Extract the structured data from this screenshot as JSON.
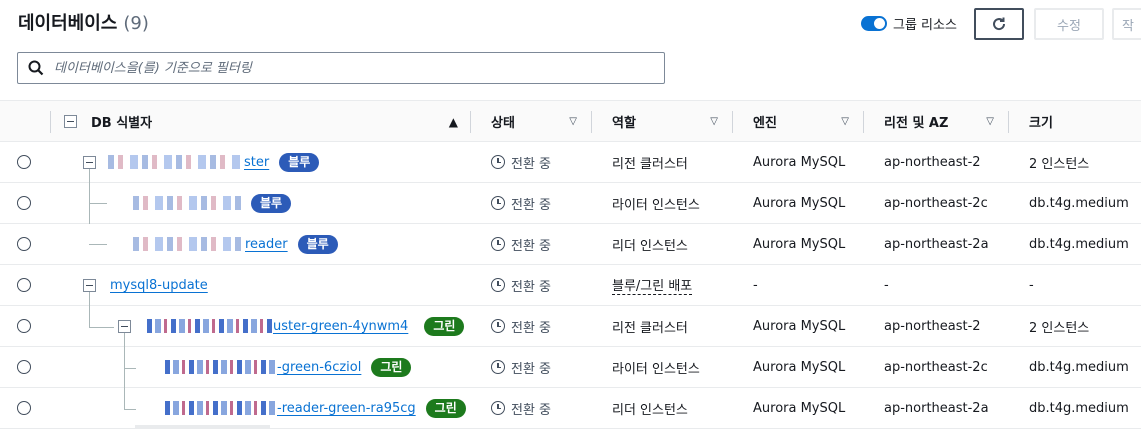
{
  "header": {
    "title": "데이터베이스",
    "count": "(9)",
    "group_toggle_label": "그룹 리소스",
    "edit_label": "수정",
    "more_label": "작"
  },
  "filter": {
    "placeholder": "데이터베이스을(를) 기준으로 필터링"
  },
  "columns": {
    "identifier": "DB 식별자",
    "status": "상태",
    "role": "역할",
    "engine": "엔진",
    "region": "리전 및 AZ",
    "size": "크기"
  },
  "rows": [
    {
      "id_suffix": "ster",
      "badge": "블루",
      "badge_color": "blue",
      "status": "전환 중",
      "role": "리전 클러스터",
      "engine": "Aurora MySQL",
      "region": "ap-northeast-2",
      "size": "2 인스턴스"
    },
    {
      "id_suffix": "",
      "badge": "블루",
      "badge_color": "blue",
      "status": "전환 중",
      "role": "라이터 인스턴스",
      "engine": "Aurora MySQL",
      "region": "ap-northeast-2c",
      "size": "db.t4g.medium"
    },
    {
      "id_suffix": "reader",
      "badge": "블루",
      "badge_color": "blue",
      "status": "전환 중",
      "role": "리더 인스턴스",
      "engine": "Aurora MySQL",
      "region": "ap-northeast-2a",
      "size": "db.t4g.medium"
    },
    {
      "id_suffix": "mysql8-update",
      "badge": "",
      "badge_color": "",
      "status": "전환 중",
      "role": "블루/그린 배포",
      "engine": "-",
      "region": "-",
      "size": "-"
    },
    {
      "id_suffix": "uster-green-4ynwm4",
      "badge": "그린",
      "badge_color": "green",
      "status": "전환 중",
      "role": "리전 클러스터",
      "engine": "Aurora MySQL",
      "region": "ap-northeast-2",
      "size": "2 인스턴스"
    },
    {
      "id_suffix": "-green-6cziol",
      "badge": "그린",
      "badge_color": "green",
      "status": "전환 중",
      "role": "라이터 인스턴스",
      "engine": "Aurora MySQL",
      "region": "ap-northeast-2c",
      "size": "db.t4g.medium"
    },
    {
      "id_suffix": "-reader-green-ra95cg",
      "badge": "그린",
      "badge_color": "green",
      "status": "전환 중",
      "role": "리더 인스턴스",
      "engine": "Aurora MySQL",
      "region": "ap-northeast-2a",
      "size": "db.t4g.medium"
    }
  ],
  "colors": {
    "accent": "#0972d3",
    "blue_badge": "#2c5bb8",
    "green_badge": "#1d7a1d"
  },
  "icons": [
    "search-icon",
    "refresh-icon",
    "clock-icon",
    "sort-ascending-icon",
    "filter-caret-icon"
  ]
}
